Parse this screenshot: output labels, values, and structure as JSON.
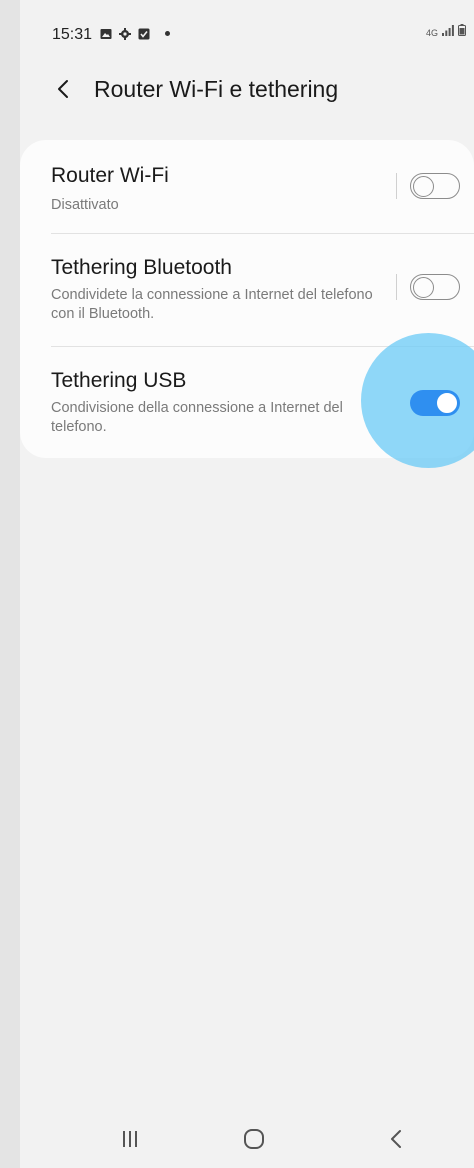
{
  "status_bar": {
    "time": "15:31",
    "network": "4G",
    "icons": [
      "gallery-icon",
      "gear-icon",
      "checklist-icon",
      "dot-icon"
    ],
    "right_icons": [
      "lte-icon",
      "signal-icon",
      "battery-icon"
    ]
  },
  "header": {
    "title": "Router Wi-Fi e tethering",
    "back_icon": "chevron-left-icon"
  },
  "settings": {
    "items": [
      {
        "title": "Router Wi-Fi",
        "subtitle": "Disattivato",
        "enabled": false
      },
      {
        "title": "Tethering Bluetooth",
        "subtitle": "Condividete la connessione a Internet del telefono con il Bluetooth.",
        "enabled": false
      },
      {
        "title": "Tethering USB",
        "subtitle": "Condivisione della connessione a Internet del telefono.",
        "enabled": true
      }
    ]
  },
  "navbar": {
    "icons": [
      "recent-apps-icon",
      "home-icon",
      "back-icon"
    ]
  },
  "colors": {
    "accent": "#2f8ff0",
    "touch_ripple": "#6fccf6",
    "background": "#f2f2f2",
    "card": "#fcfcfc"
  }
}
